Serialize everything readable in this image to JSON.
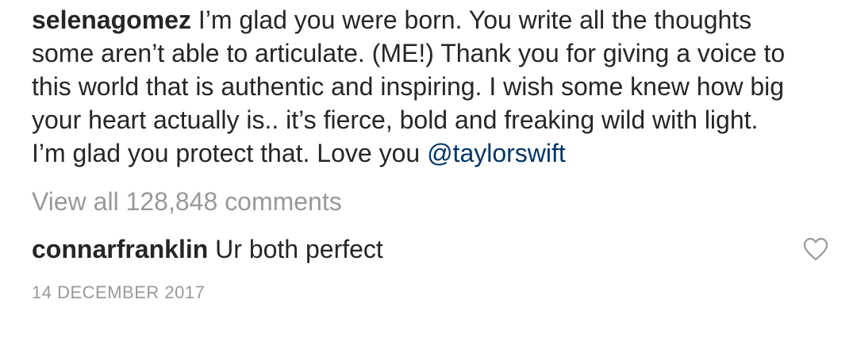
{
  "post": {
    "author": "selenagomez",
    "caption_text": "I’m glad you were born. You write all the thoughts some aren’t able to articulate. (ME!) Thank you for giving a voice to this world that is authentic and inspiring. I wish some knew how big your heart actually is.. it’s fierce, bold and freaking wild with light. I’m glad you protect that. Love you",
    "mention": "@taylorswift"
  },
  "comments": {
    "view_all_label": "View all 128,848 comments",
    "items": [
      {
        "username": "connarfranklin",
        "text": "Ur both perfect",
        "like_icon": "heart-outline-icon"
      }
    ]
  },
  "timestamp": "14 DECEMBER 2017",
  "colors": {
    "text": "#262626",
    "muted": "#999999",
    "mention": "#003569"
  }
}
